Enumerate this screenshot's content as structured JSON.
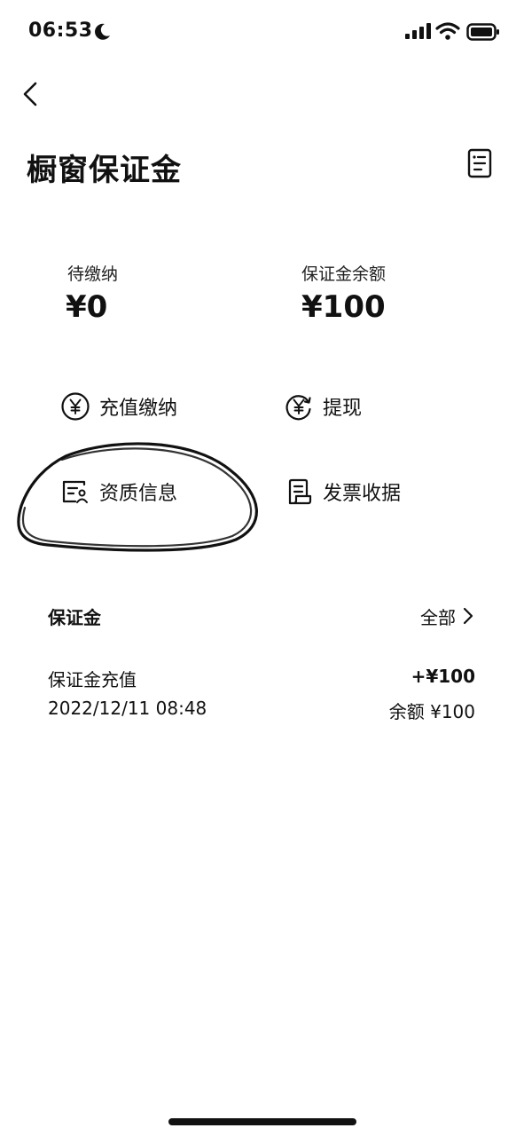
{
  "status_bar": {
    "time": "06:53",
    "icons": [
      "moon-icon",
      "signal-icon",
      "wifi-icon",
      "battery-icon"
    ]
  },
  "header": {
    "title": "橱窗保证金",
    "back_icon": "chevron-left-icon",
    "action_icon": "document-list-icon"
  },
  "summary": {
    "pending_label": "待缴纳",
    "pending_value": "¥0",
    "balance_label": "保证金余额",
    "balance_value": "¥100"
  },
  "actions": [
    {
      "label": "充值缴纳",
      "icon": "yen-circle-icon"
    },
    {
      "label": "提现",
      "icon": "yen-refresh-icon"
    },
    {
      "label": "资质信息",
      "icon": "id-card-icon"
    },
    {
      "label": "发票收据",
      "icon": "receipt-icon"
    }
  ],
  "records_section": {
    "title": "保证金",
    "all_label": "全部",
    "items": [
      {
        "title": "保证金充值",
        "time": "2022/12/11 08:48",
        "amount": "+¥100",
        "balance": "余额 ¥100"
      }
    ]
  },
  "colors": {
    "text": "#111111",
    "background": "#ffffff",
    "annotation": "#111111"
  }
}
